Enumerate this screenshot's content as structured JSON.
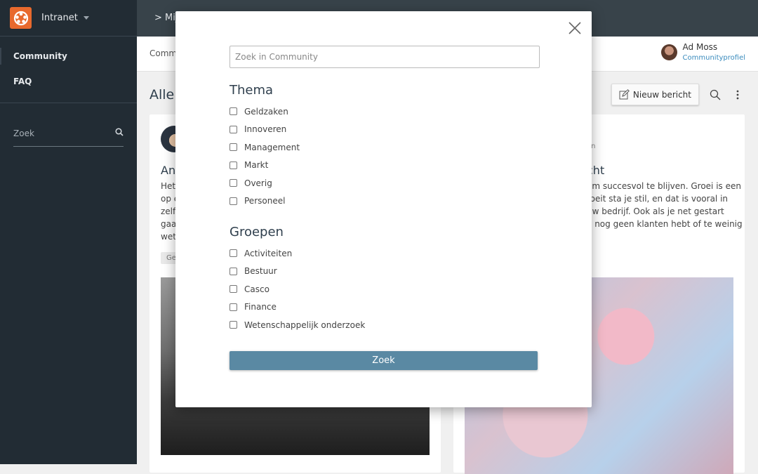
{
  "sidebar": {
    "app_name": "Intranet",
    "items": [
      {
        "label": "Community",
        "active": true
      },
      {
        "label": "FAQ",
        "active": false
      }
    ],
    "search_placeholder": "Zoek"
  },
  "topbar": {
    "breadcrumb": "> Mij"
  },
  "subbar": {
    "crumb": "Commu",
    "user_name": "Ad Moss",
    "user_link": "Communityprofiel"
  },
  "main": {
    "title": "Alle",
    "new_post_label": "Nieuw bericht",
    "cards": [
      {
        "title": "An",
        "text_lines": [
          "Het",
          "op e",
          "zelf",
          "gaa",
          "wet"
        ],
        "tag": "Ge"
      },
      {
        "meta": "en",
        "title": "cht",
        "text_lines": [
          "om succesvol te blijven. Groei is een",
          "roeit sta je stil, en dat is vooral in",
          "uw bedrijf. Ook als je net gestart",
          "e nog geen klanten hebt of te weinig"
        ]
      }
    ]
  },
  "modal": {
    "search_placeholder": "Zoek in Community",
    "search_value": "",
    "sections": [
      {
        "title": "Thema",
        "options": [
          "Geldzaken",
          "Innoveren",
          "Management",
          "Markt",
          "Overig",
          "Personeel"
        ]
      },
      {
        "title": "Groepen",
        "options": [
          "Activiteiten",
          "Bestuur",
          "Casco",
          "Finance",
          "Wetenschappelijk onderzoek"
        ]
      }
    ],
    "submit_label": "Zoek"
  },
  "colors": {
    "brand": "#e8692d",
    "sidebar": "#222c34",
    "topbar": "#38434a",
    "primary_button": "#5a89a3",
    "link": "#3a8bbd"
  }
}
